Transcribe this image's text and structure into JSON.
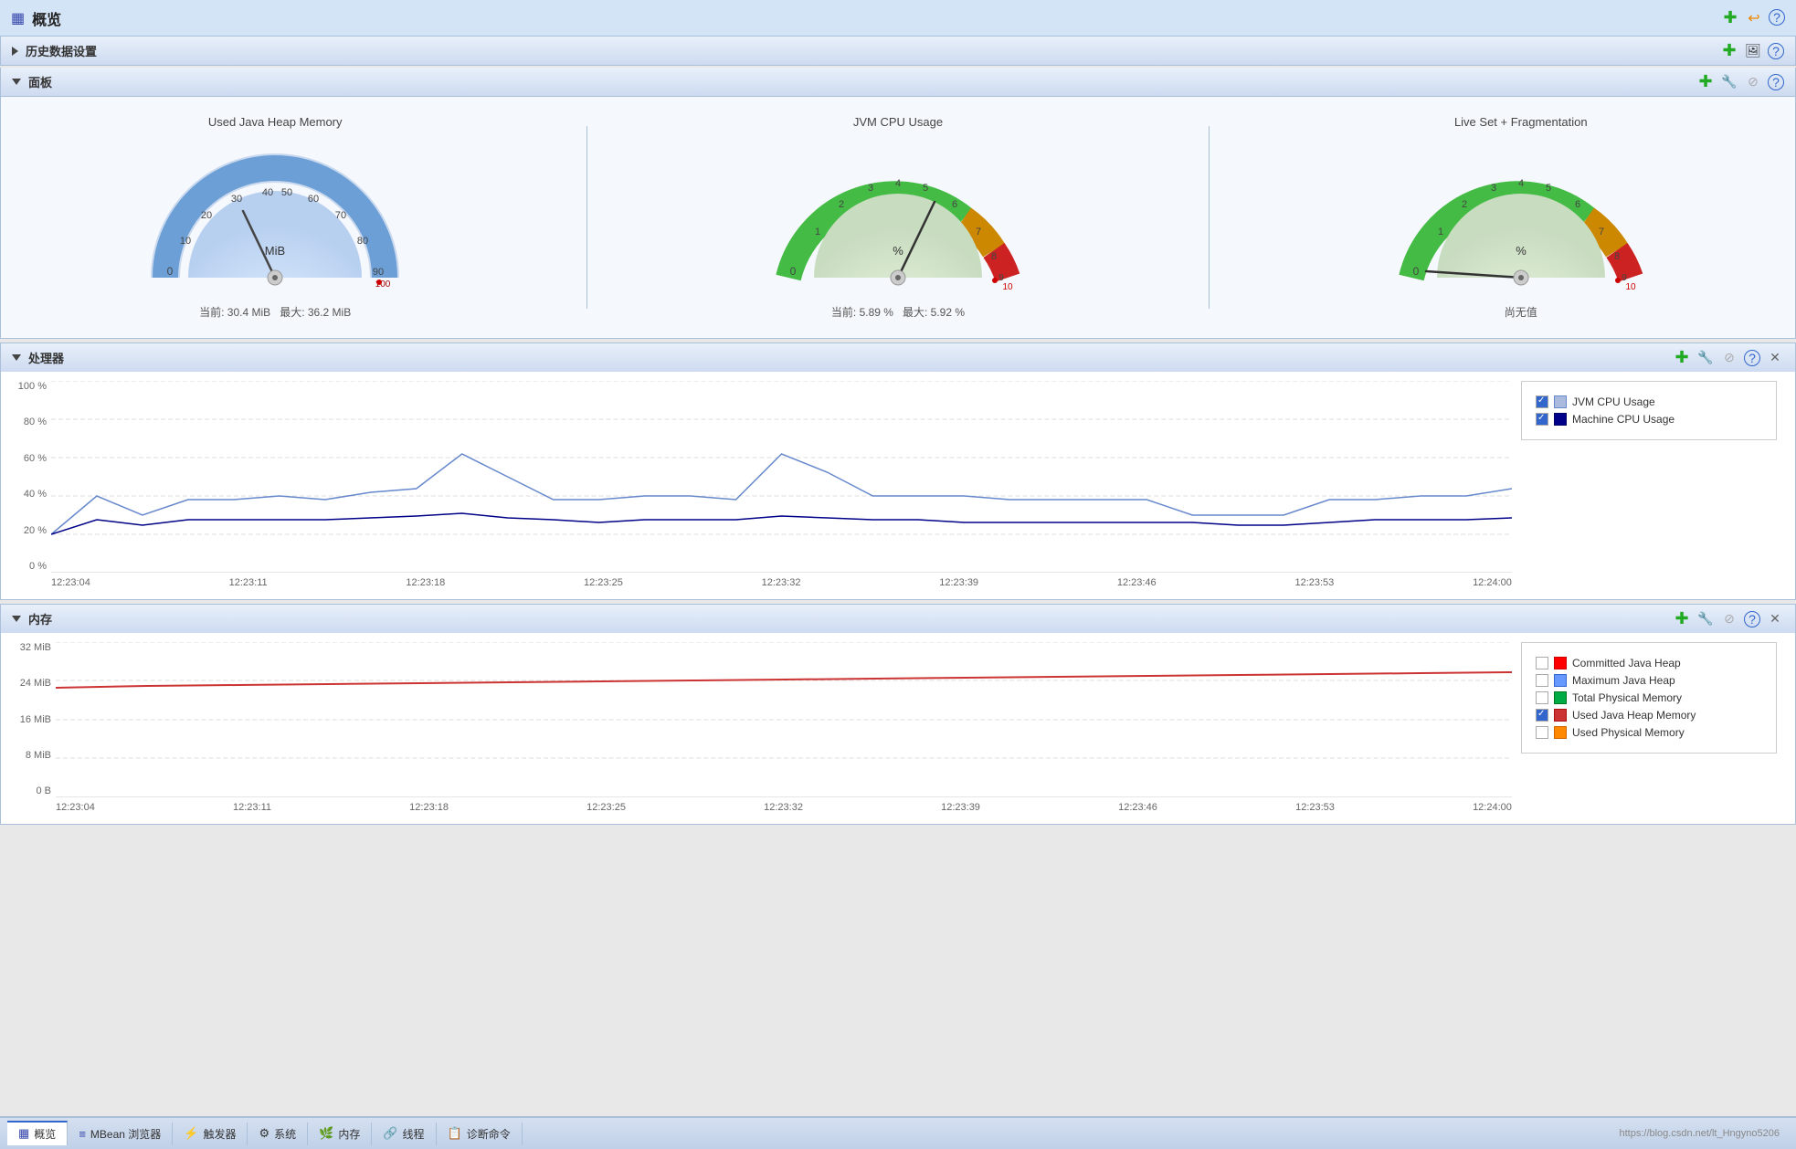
{
  "header": {
    "icon": "▦",
    "title": "概览",
    "buttons": [
      "+",
      "↩",
      "?"
    ]
  },
  "history_section": {
    "title": "历史数据设置",
    "collapsed": true,
    "actions": [
      "+",
      "🖼",
      "?"
    ]
  },
  "panel_section": {
    "title": "面板",
    "collapsed": false,
    "actions": [
      "+",
      "🔧",
      "⊘",
      "?"
    ],
    "gauges": [
      {
        "title": "Used Java Heap Memory",
        "unit": "MiB",
        "current_label": "当前: 30.4 MiB",
        "max_label": "最大: 36.2 MiB",
        "value": 30.4,
        "max": 100,
        "color_zones": [
          "blue",
          "blue",
          "blue"
        ]
      },
      {
        "title": "JVM CPU Usage",
        "unit": "%",
        "current_label": "当前: 5.89 %",
        "max_label": "最大: 5.92 %",
        "value": 5.89,
        "max": 10,
        "color_zones": [
          "green",
          "yellow",
          "red"
        ]
      },
      {
        "title": "Live Set + Fragmentation",
        "unit": "%",
        "current_label": "尚无值",
        "max_label": "",
        "value": 0,
        "max": 10,
        "color_zones": [
          "green",
          "yellow",
          "red"
        ]
      }
    ]
  },
  "processor_section": {
    "title": "处理器",
    "actions": [
      "+",
      "🔧",
      "⊘",
      "?",
      "✕"
    ],
    "y_labels": [
      "100 %",
      "80 %",
      "60 %",
      "40 %",
      "20 %",
      "0 %"
    ],
    "x_labels": [
      "12:23:04",
      "12:23:11",
      "12:23:18",
      "12:23:25",
      "12:23:32",
      "12:23:39",
      "12:23:46",
      "12:23:53",
      "12:24:00"
    ],
    "legend": [
      {
        "label": "JVM CPU Usage",
        "color": "#aabbdd",
        "checked": true
      },
      {
        "label": "Machine CPU Usage",
        "color": "#000088",
        "checked": true
      }
    ]
  },
  "memory_section": {
    "title": "内存",
    "actions": [
      "+",
      "🔧",
      "⊘",
      "?",
      "✕"
    ],
    "y_labels": [
      "32 MiB",
      "24 MiB",
      "16 MiB",
      "8 MiB",
      "0 B"
    ],
    "x_labels": [
      "12:23:04",
      "12:23:11",
      "12:23:18",
      "12:23:25",
      "12:23:32",
      "12:23:39",
      "12:23:46",
      "12:23:53",
      "12:24:00"
    ],
    "legend": [
      {
        "label": "Committed Java Heap",
        "color": "#ff0000",
        "checked": false
      },
      {
        "label": "Maximum Java Heap",
        "color": "#6699ff",
        "checked": false
      },
      {
        "label": "Total Physical Memory",
        "color": "#00aa44",
        "checked": false
      },
      {
        "label": "Used Java Heap Memory",
        "color": "#cc3333",
        "checked": true
      },
      {
        "label": "Used Physical Memory",
        "color": "#ff8800",
        "checked": false
      }
    ]
  },
  "tabs": [
    {
      "label": "概览",
      "active": true,
      "icon": "▦"
    },
    {
      "label": "MBean 浏览器",
      "active": false,
      "icon": "≡"
    },
    {
      "label": "触发器",
      "active": false,
      "icon": "⚡"
    },
    {
      "label": "系统",
      "active": false,
      "icon": "⚙"
    },
    {
      "label": "内存",
      "active": false,
      "icon": "🌿"
    },
    {
      "label": "线程",
      "active": false,
      "icon": "🔗"
    },
    {
      "label": "诊断命令",
      "active": false,
      "icon": "📋"
    }
  ],
  "status_bar": {
    "url": "https://blog.csdn.net/lt_Hngyno5206"
  }
}
